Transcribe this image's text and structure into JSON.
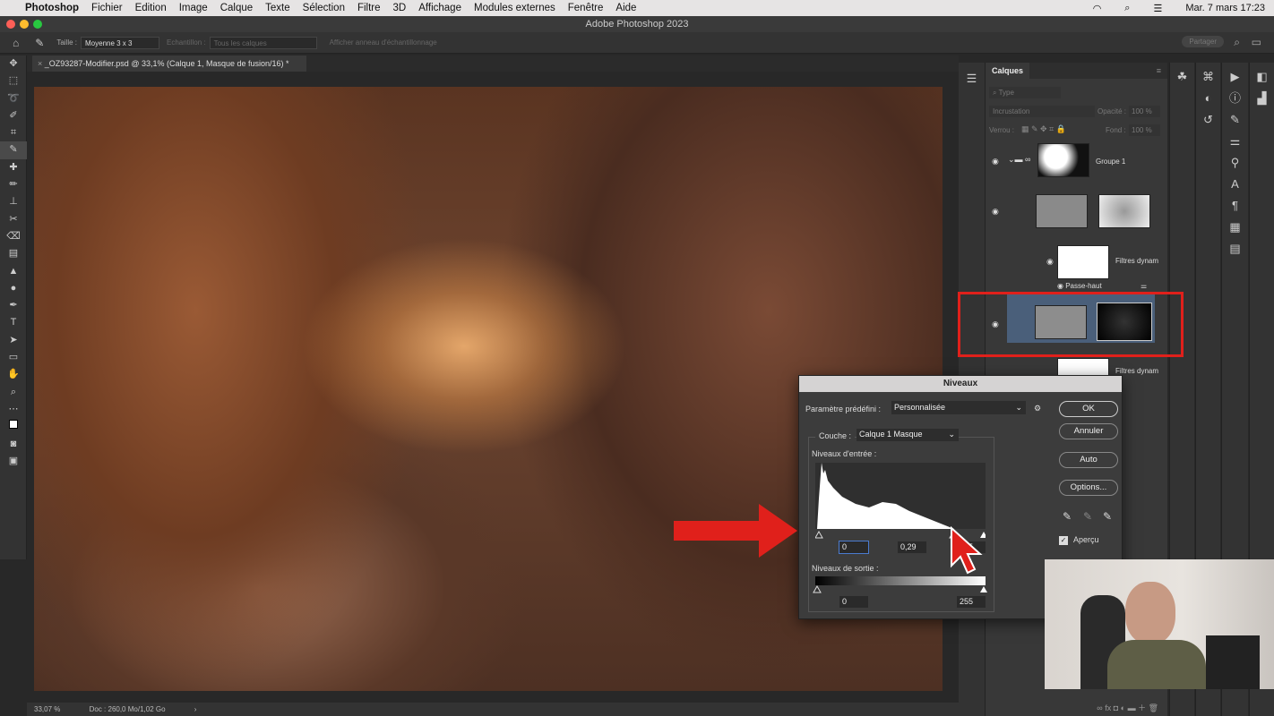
{
  "menubar": {
    "app": "Photoshop",
    "items": [
      "Fichier",
      "Edition",
      "Image",
      "Calque",
      "Texte",
      "Sélection",
      "Filtre",
      "3D",
      "Affichage",
      "Modules externes",
      "Fenêtre",
      "Aide"
    ],
    "datetime": "Mar. 7 mars  17:23"
  },
  "window": {
    "title": "Adobe Photoshop 2023"
  },
  "options": {
    "size_label": "Taille :",
    "size_value": "Moyenne 3 x 3",
    "sample_label": "Echantillon :",
    "sample_value": "Tous les calques",
    "ring_label": "Afficher anneau d'échantillonnage",
    "share": "Partager"
  },
  "document": {
    "tab": "_OZ93287-Modifier.psd @ 33,1% (Calque 1, Masque de fusion/16) *",
    "zoom": "33,07 %",
    "doc_size": "Doc : 260,0 Mo/1,02 Go"
  },
  "layers": {
    "title": "Calques",
    "filter_placeholder": "Type",
    "blend_mode": "Incrustation",
    "opacity_label": "Opacité :",
    "opacity": "100 %",
    "lock_label": "Verrou :",
    "fill_label": "Fond :",
    "fill": "100 %",
    "items": [
      {
        "name": "Groupe 1"
      },
      {
        "name": "Filtres dynam"
      },
      {
        "name": "Passe-haut"
      },
      {
        "name": "Filtres dynam"
      }
    ]
  },
  "levels": {
    "title": "Niveaux",
    "preset_label": "Paramètre prédéfini :",
    "preset": "Personnalisée",
    "channel_label": "Couche :",
    "channel": "Calque 1 Masque",
    "input_label": "Niveaux d'entrée :",
    "input_black": "0",
    "input_gamma": "0,29",
    "input_white": "255",
    "output_label": "Niveaux de sortie :",
    "output_black": "0",
    "output_white": "255",
    "buttons": {
      "ok": "OK",
      "cancel": "Annuler",
      "auto": "Auto",
      "options": "Options..."
    },
    "preview_label": "Aperçu",
    "preview_checked": true
  },
  "colors": {
    "annotation": "#e0201b",
    "selected_layer": "#4a5f7a"
  }
}
